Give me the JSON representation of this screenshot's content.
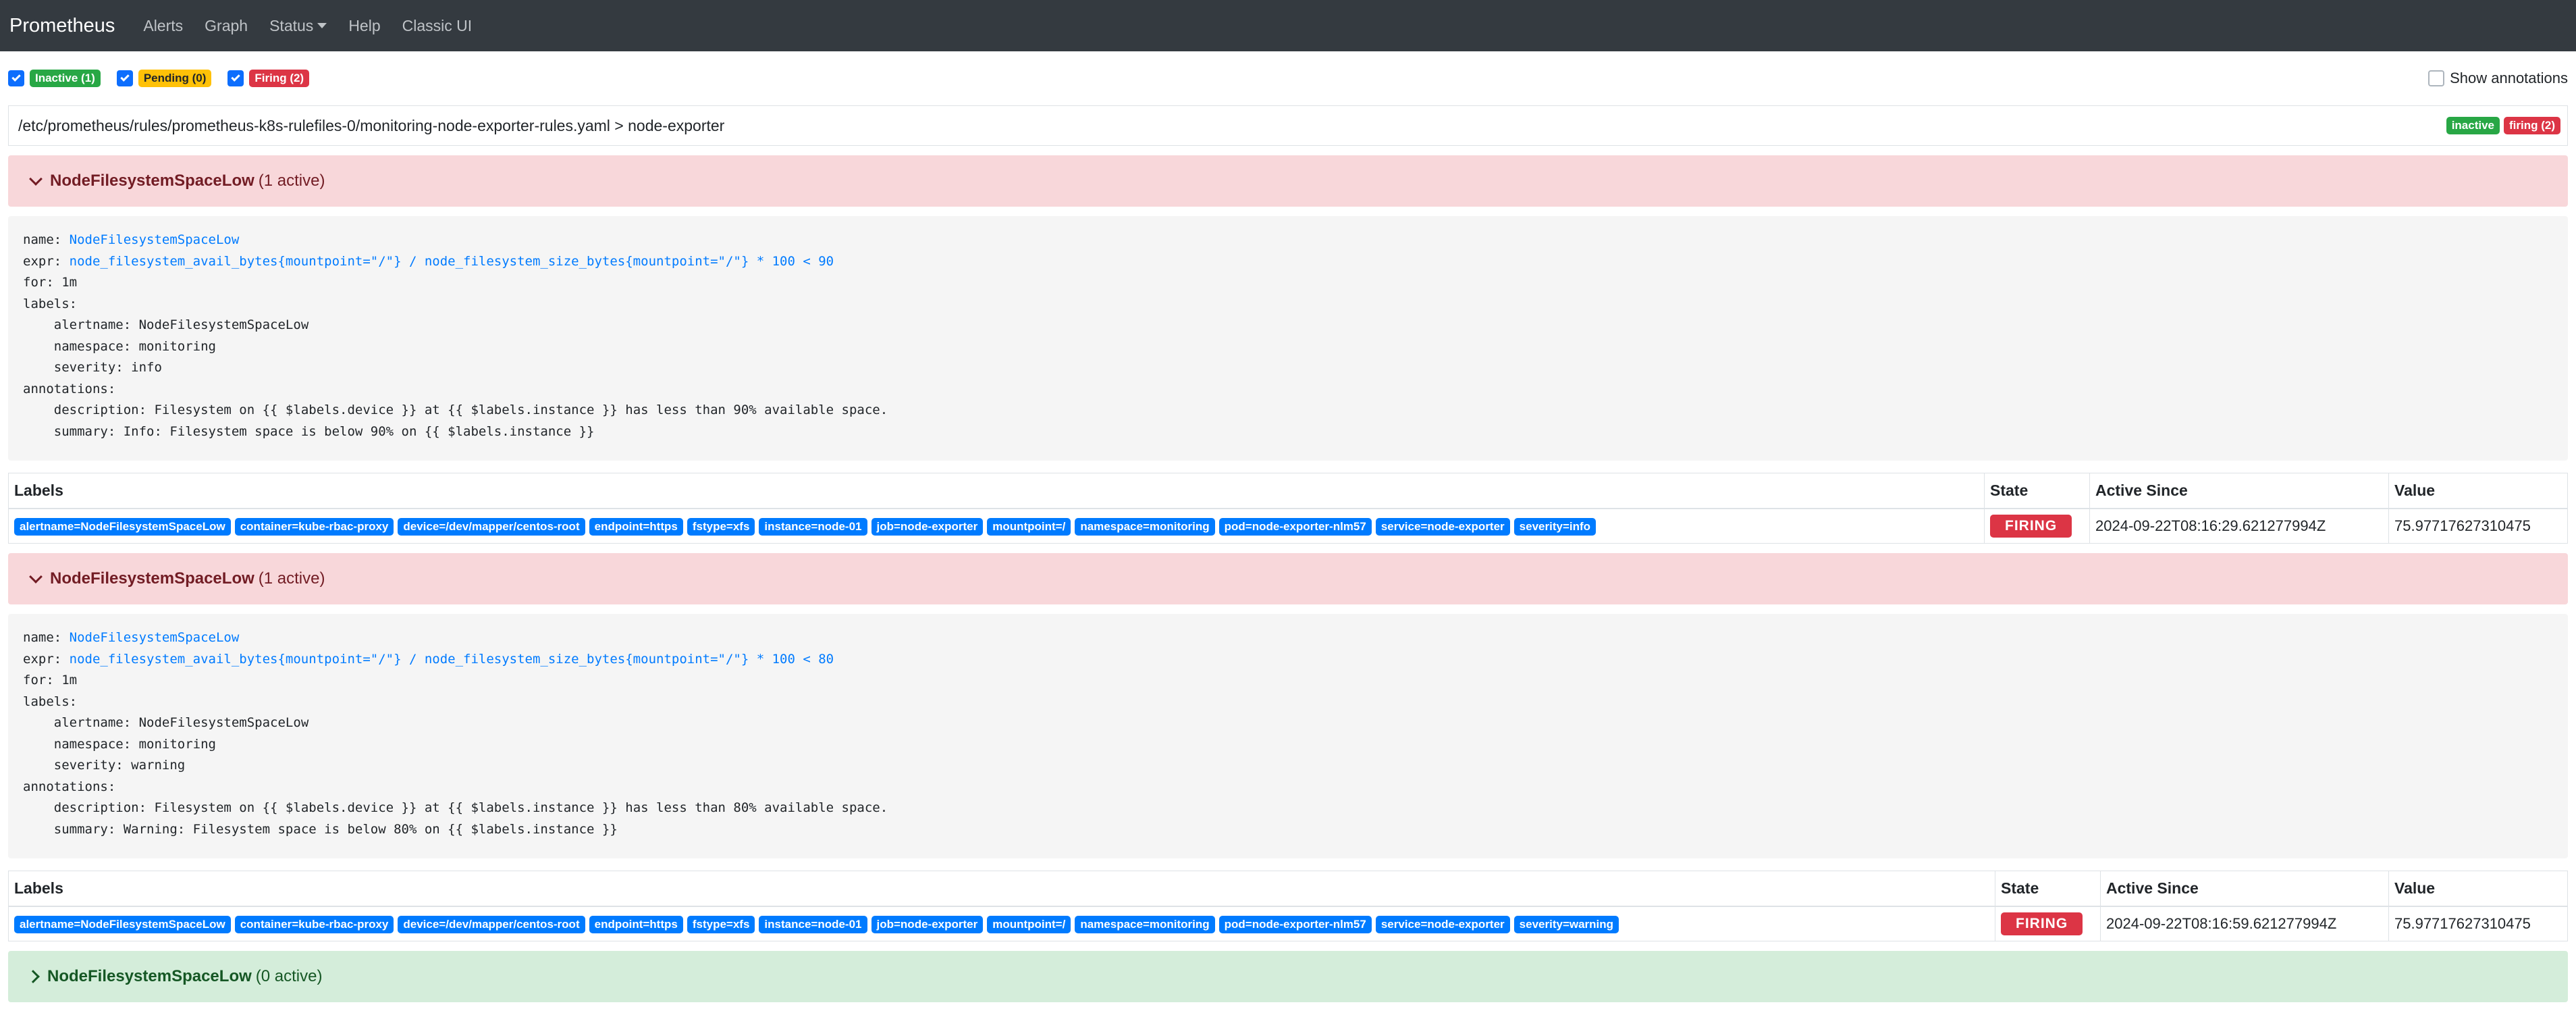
{
  "nav": {
    "brand": "Prometheus",
    "links": [
      "Alerts",
      "Graph",
      "Status",
      "Help",
      "Classic UI"
    ]
  },
  "filters": {
    "inactive": "Inactive (1)",
    "pending": "Pending (0)",
    "firing": "Firing (2)",
    "show_annotations": "Show annotations"
  },
  "group": {
    "path": "/etc/prometheus/rules/prometheus-k8s-rulefiles-0/monitoring-node-exporter-rules.yaml > node-exporter",
    "badge_inactive": "inactive",
    "badge_firing": "firing (2)"
  },
  "table_headers": {
    "labels": "Labels",
    "state": "State",
    "active_since": "Active Since",
    "value": "Value"
  },
  "rules": [
    {
      "name": "NodeFilesystemSpaceLow",
      "count": "(1 active)",
      "expr": "node_filesystem_avail_bytes{mountpoint=\"/\"} / node_filesystem_size_bytes{mountpoint=\"/\"} * 100 < 90",
      "for": "1m",
      "label_lines": [
        "alertname: NodeFilesystemSpaceLow",
        "namespace: monitoring",
        "severity: info"
      ],
      "annotation_lines": [
        "description: Filesystem on {{ $labels.device }} at {{ $labels.instance }} has less than 90% available space.",
        "summary: Info: Filesystem space is below 90% on {{ $labels.instance }}"
      ],
      "alert": {
        "labels": [
          "alertname=NodeFilesystemSpaceLow",
          "container=kube-rbac-proxy",
          "device=/dev/mapper/centos-root",
          "endpoint=https",
          "fstype=xfs",
          "instance=node-01",
          "job=node-exporter",
          "mountpoint=/",
          "namespace=monitoring",
          "pod=node-exporter-nlm57",
          "service=node-exporter",
          "severity=info"
        ],
        "state": "FIRING",
        "active_since": "2024-09-22T08:16:29.621277994Z",
        "value": "75.97717627310475"
      }
    },
    {
      "name": "NodeFilesystemSpaceLow",
      "count": "(1 active)",
      "expr": "node_filesystem_avail_bytes{mountpoint=\"/\"} / node_filesystem_size_bytes{mountpoint=\"/\"} * 100 < 80",
      "for": "1m",
      "label_lines": [
        "alertname: NodeFilesystemSpaceLow",
        "namespace: monitoring",
        "severity: warning"
      ],
      "annotation_lines": [
        "description: Filesystem on {{ $labels.device }} at {{ $labels.instance }} has less than 80% available space.",
        "summary: Warning: Filesystem space is below 80% on {{ $labels.instance }}"
      ],
      "alert": {
        "labels": [
          "alertname=NodeFilesystemSpaceLow",
          "container=kube-rbac-proxy",
          "device=/dev/mapper/centos-root",
          "endpoint=https",
          "fstype=xfs",
          "instance=node-01",
          "job=node-exporter",
          "mountpoint=/",
          "namespace=monitoring",
          "pod=node-exporter-nlm57",
          "service=node-exporter",
          "severity=warning"
        ],
        "state": "FIRING",
        "active_since": "2024-09-22T08:16:59.621277994Z",
        "value": "75.97717627310475"
      }
    },
    {
      "name": "NodeFilesystemSpaceLow",
      "count": "(0 active)"
    }
  ],
  "pre_keys": {
    "name": "name: ",
    "expr": "expr: ",
    "for": "for: ",
    "labels": "labels:",
    "annotations": "annotations:"
  }
}
